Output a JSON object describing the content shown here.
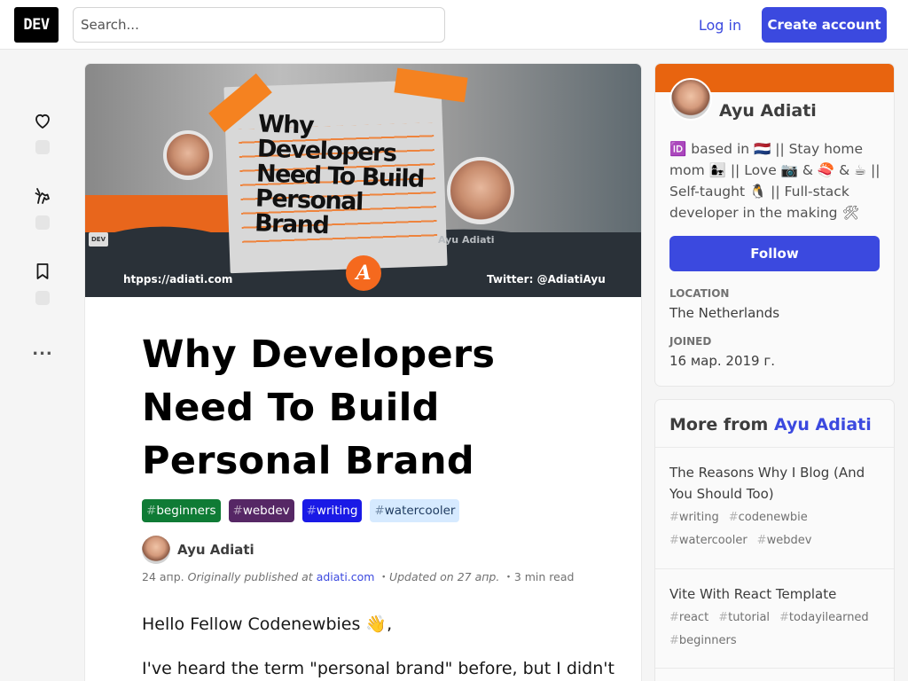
{
  "header": {
    "logo_text": "DEV",
    "search_placeholder": "Search...",
    "login_label": "Log in",
    "create_account_label": "Create account"
  },
  "rail": {
    "more_label": "..."
  },
  "article": {
    "cover": {
      "title_lines": [
        "Why",
        "Developers",
        "Need To Build",
        "Personal",
        "Brand"
      ],
      "url_text": "htpps://adiati.com",
      "twitter_text": "Twitter: @AdiatiAyu",
      "blurred_name": "Ayu Adiati",
      "badge_text": "DEV",
      "logo_letter": "A"
    },
    "title": "Why Developers Need To Build Personal Brand",
    "tags": [
      {
        "hash": "#",
        "name": "beginners",
        "bg": "#0f7b35",
        "fg": "#ffffff"
      },
      {
        "hash": "#",
        "name": "webdev",
        "bg": "#562765",
        "fg": "#ffffff"
      },
      {
        "hash": "#",
        "name": "writing",
        "bg": "#1a1ae6",
        "fg": "#ffffff"
      },
      {
        "hash": "#",
        "name": "watercooler",
        "bg": "#d6eaff",
        "fg": "#1e3a5f"
      }
    ],
    "author": "Ayu Adiati",
    "meta": {
      "date": "24 апр.",
      "originally": "Originally published at",
      "source": "adiati.com",
      "updated": "Updated on 27 апр.",
      "read_time": "3 min read",
      "sep": "・"
    },
    "paragraphs": [
      "Hello Fellow Codenewbies 👋,",
      "I've heard the term \"personal brand\" before, but I didn't"
    ]
  },
  "profile": {
    "name": "Ayu Adiati",
    "bio": "🆔 based in 🇳🇱 || Stay home mom 👩‍👧 || Love 📷 & 🍣 & ☕ || Self-taught 🐧 || Full-stack developer in the making 🛠",
    "follow_label": "Follow",
    "location_label": "LOCATION",
    "location_value": "The Netherlands",
    "joined_label": "JOINED",
    "joined_value": "16 мар. 2019 г."
  },
  "more_from": {
    "prefix": "More from",
    "author": "Ayu Adiati",
    "items": [
      {
        "title": "The Reasons Why I Blog (And You Should Too)",
        "tags": [
          "writing",
          "codenewbie",
          "watercooler",
          "webdev"
        ]
      },
      {
        "title": "Vite With React Template",
        "tags": [
          "react",
          "tutorial",
          "todayilearned",
          "beginners"
        ]
      }
    ]
  },
  "colors": {
    "accent": "#3b49df",
    "profile_brand": "#e8640f"
  }
}
